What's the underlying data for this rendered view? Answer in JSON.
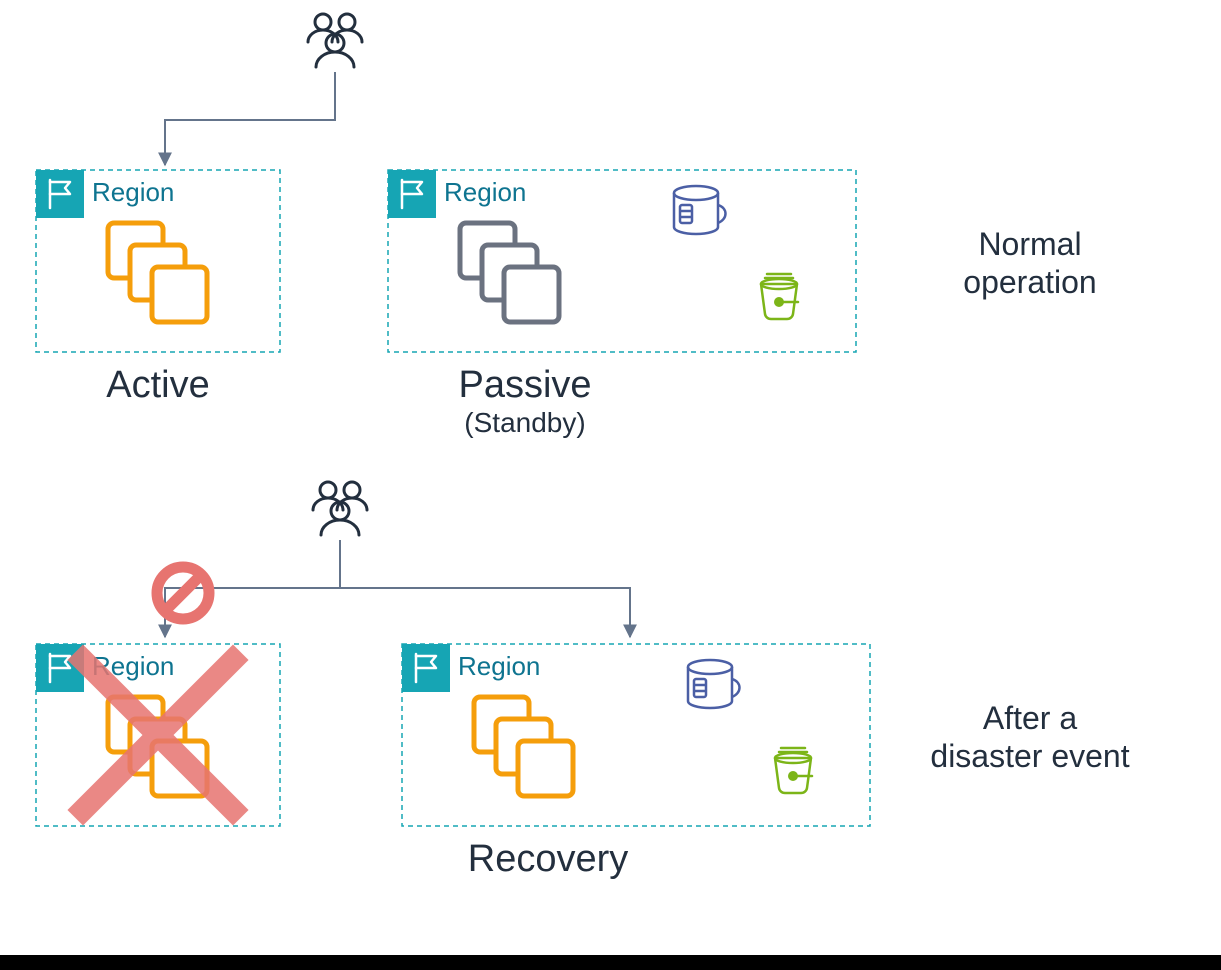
{
  "labels": {
    "region_active_top": "Region",
    "region_passive_top": "Region",
    "region_active_bottom": "Region",
    "region_recovery_bottom": "Region",
    "active": "Active",
    "passive": "Passive",
    "standby": "(Standby)",
    "recovery": "Recovery",
    "normal_line1": "Normal",
    "normal_line2": "operation",
    "after_line1": "After a",
    "after_line2": "disaster event"
  },
  "colors": {
    "regionFill": "#16A5B4",
    "orange": "#F59E0B",
    "grey": "#6B7280",
    "text": "#232F3E",
    "regionText": "#0E7490",
    "arrow": "#64748B",
    "dashed": "#16A5B4",
    "db": "#4B5FA5",
    "green": "#7CB518",
    "red": "#E77470",
    "users": "#232F3E"
  }
}
